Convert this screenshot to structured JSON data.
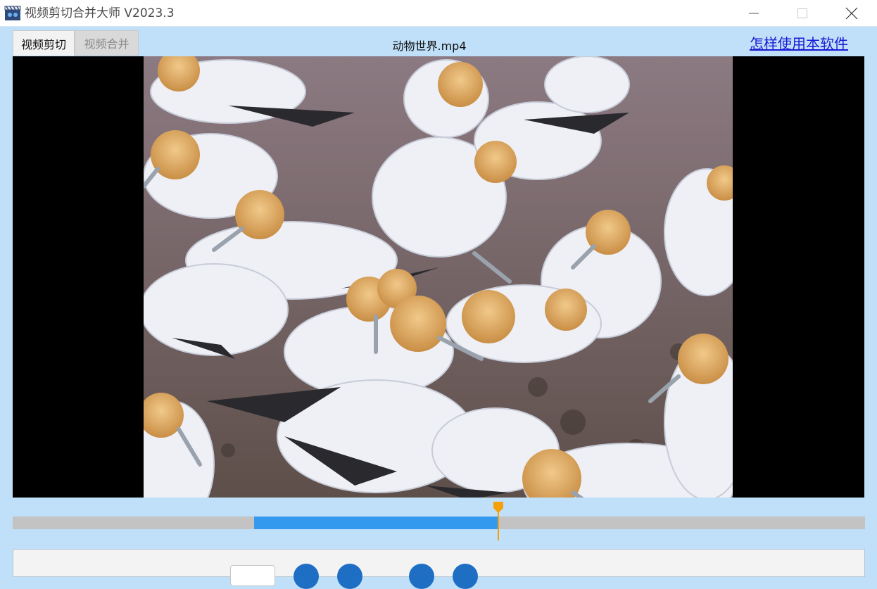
{
  "window": {
    "title": "视频剪切合并大师 V2023.3",
    "icon": "film-clapper-icon",
    "controls": [
      "minimize-icon",
      "maximize-icon",
      "close-icon"
    ]
  },
  "tabs": [
    {
      "label": "视频剪切",
      "active": true
    },
    {
      "label": "视频合并",
      "active": false
    }
  ],
  "file_name": "动物世界.mp4",
  "help_link": "怎样使用本软件",
  "timeline": {
    "selection_start": 0.283,
    "selection_end": 0.57,
    "playhead": 0.57
  },
  "colors": {
    "background": "#bfe0f8",
    "selection": "#3399ee",
    "playhead": "#f5a00a",
    "link": "#1a1ad6"
  }
}
